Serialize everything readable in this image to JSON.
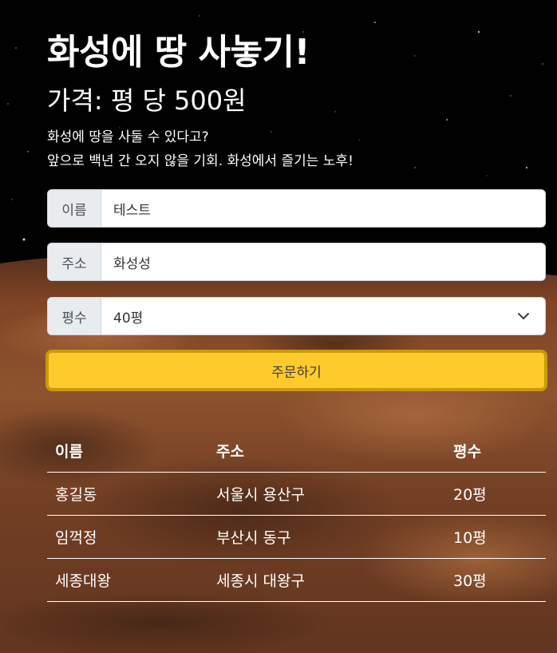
{
  "header": {
    "title": "화성에 땅 사놓기!",
    "price": "가격: 평 당 500원",
    "description_line1": "화성에 땅을 사둘 수 있다고?",
    "description_line2": "앞으로 백년 간 오지 않을 기회. 화성에서 즐기는 노후!"
  },
  "form": {
    "name": {
      "label": "이름",
      "value": "테스트"
    },
    "address": {
      "label": "주소",
      "value": "화성성"
    },
    "size": {
      "label": "평수",
      "selected": "40평"
    },
    "submit_label": "주문하기"
  },
  "table": {
    "columns": [
      "이름",
      "주소",
      "평수"
    ],
    "rows": [
      [
        "홍길동",
        "서울시 용산구",
        "20평"
      ],
      [
        "임꺽정",
        "부산시 동구",
        "10평"
      ],
      [
        "세종대왕",
        "세종시 대왕구",
        "30평"
      ]
    ]
  },
  "colors": {
    "button": "#ffca2c",
    "button_border": "#c99a0a",
    "text": "#ffffff",
    "label_bg": "#e9ecef"
  },
  "icons": {
    "select_arrow": "chevron-down-icon"
  }
}
